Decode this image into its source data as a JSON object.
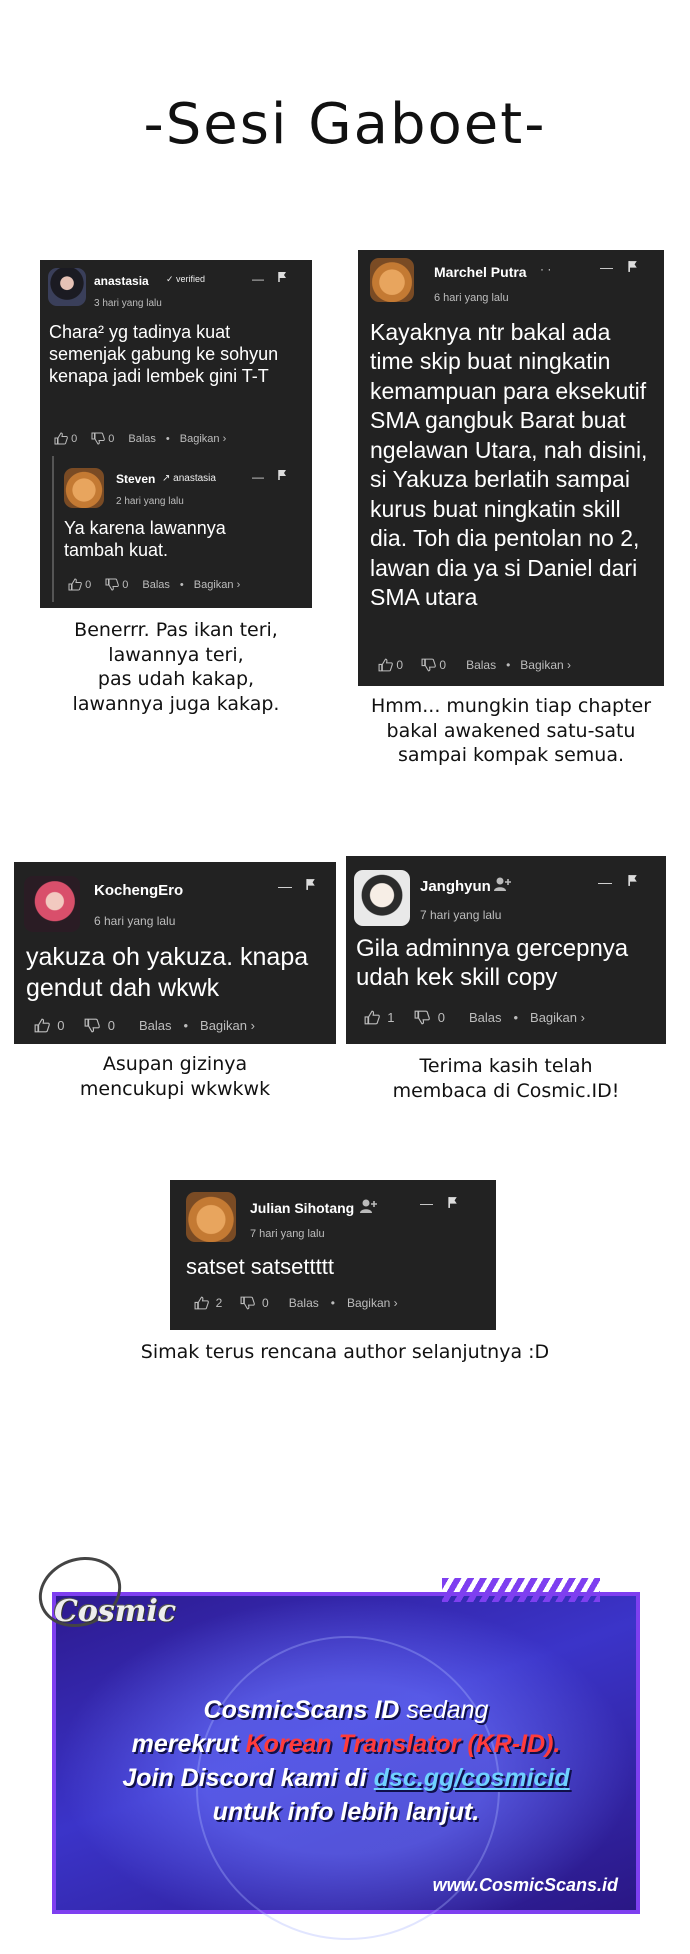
{
  "page_title": "-Sesi Gaboet-",
  "common": {
    "likes_icon": "thumb-up-icon",
    "dislike_icon": "thumb-down-icon",
    "reply": "Balas",
    "share": "Bagikan ›",
    "sep": "•",
    "minimize": "—",
    "flag_icon": "flag-icon"
  },
  "card1": {
    "user": "anastasia",
    "badge": "✓ verified",
    "time": "3 hari yang lalu",
    "text": "Chara² yg tadinya kuat semenjak gabung ke sohyun kenapa jadi lembek gini T-T",
    "likes": "0",
    "dislikes": "0",
    "reply": {
      "user": "Steven",
      "reply_to": "↗ anastasia",
      "time": "2 hari yang lalu",
      "text": "Ya karena lawannya tambah kuat.",
      "likes": "0",
      "dislikes": "0"
    },
    "caption": [
      "Benerrr. Pas ikan teri,",
      "lawannya teri,",
      "pas udah kakap,",
      "lawannya juga kakap."
    ]
  },
  "card2": {
    "user": "Marchel Putra",
    "time": "6 hari yang lalu",
    "text": "Kayaknya ntr bakal ada time skip buat ningkatin kemampuan para eksekutif SMA gangbuk Barat buat ngelawan Utara, nah disini, si Yakuza berlatih sampai kurus buat ningkatin skill dia. Toh dia pentolan no 2, lawan dia ya si Daniel dari SMA utara",
    "likes": "0",
    "dislikes": "0",
    "caption": [
      "Hmm... mungkin tiap chapter",
      "bakal awakened satu-satu",
      "sampai kompak semua."
    ]
  },
  "card3": {
    "user": "KochengEro",
    "time": "6 hari yang lalu",
    "text": "yakuza oh yakuza. knapa gendut dah wkwk",
    "likes": "0",
    "dislikes": "0",
    "caption": [
      "Asupan gizinya",
      "mencukupi wkwkwk"
    ]
  },
  "card4": {
    "user": "Janghyun",
    "time": "7 hari yang lalu",
    "text": "Gila adminnya gercepnya udah kek skill copy",
    "likes": "1",
    "dislikes": "0",
    "caption": [
      "Terima kasih telah",
      "membaca di Cosmic.ID!"
    ]
  },
  "card5": {
    "user": "Julian Sihotang",
    "time": "7 hari yang lalu",
    "text": "satset satsettttt",
    "likes": "2",
    "dislikes": "0",
    "caption": [
      "Simak terus rencana author selanjutnya :D"
    ]
  },
  "banner": {
    "logo": "Cosmic",
    "line1_a": "CosmicScans ID",
    "line1_b": " sedang",
    "line2_a": "merekrut ",
    "line2_b": "Korean Translator (KR-ID).",
    "line3_a": "Join Discord kami di ",
    "line3_b": "dsc.gg/cosmicid",
    "line4": "untuk info lebih lanjut.",
    "site": "www.CosmicScans.id"
  },
  "colors": {
    "card_bg": "#222222",
    "banner_border": "#7e3ff0",
    "banner_red": "#ff3b3b",
    "banner_link": "#6fd1ff"
  }
}
